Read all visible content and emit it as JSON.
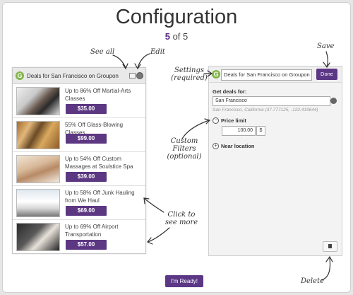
{
  "title": "Configuration",
  "step": {
    "current": "5",
    "suffix": "of 5"
  },
  "left_widget": {
    "title": "Deals for San Francisco on Groupon",
    "logo": "G",
    "deals": [
      {
        "text": "Up to 86% Off Martial-Arts Classes",
        "price": "$35.00"
      },
      {
        "text": "55% Off Glass-Blowing Classes",
        "price": "$99.00"
      },
      {
        "text": "Up to 54% Off Custom Massages at Soulstice Spa",
        "price": "$39.00"
      },
      {
        "text": "Up to 58% Off Junk Hauling from We Haul",
        "price": "$69.00"
      },
      {
        "text": "Up to 69% Off Airport Transportation",
        "price": "$57.00"
      }
    ]
  },
  "right_widget": {
    "logo": "G",
    "title_value": "Deals for San Francisco on Groupon",
    "done_label": "Done",
    "get_deals_label": "Get deals for:",
    "location_value": "San Francisco",
    "coords": "San Francisco, California (37.777125, -122.419644)",
    "price_limit_label": "Price limit",
    "price_limit_value": "100.00",
    "currency": "$",
    "near_location_label": "Near location"
  },
  "ready_label": "I'm Ready!",
  "annotations": {
    "see_all": "See all",
    "edit": "Edit",
    "save": "Save",
    "settings_1": "Settings",
    "settings_2": "(required)",
    "custom_1": "Custom Filters",
    "custom_2": "(optional)",
    "click_1": "Click to",
    "click_2": "see more",
    "delete": "Delete"
  },
  "icons": [
    "groupon-logo-icon",
    "external-link-icon",
    "gear-icon",
    "globe-icon",
    "minus-circle-icon",
    "plus-circle-icon",
    "trash-icon"
  ]
}
